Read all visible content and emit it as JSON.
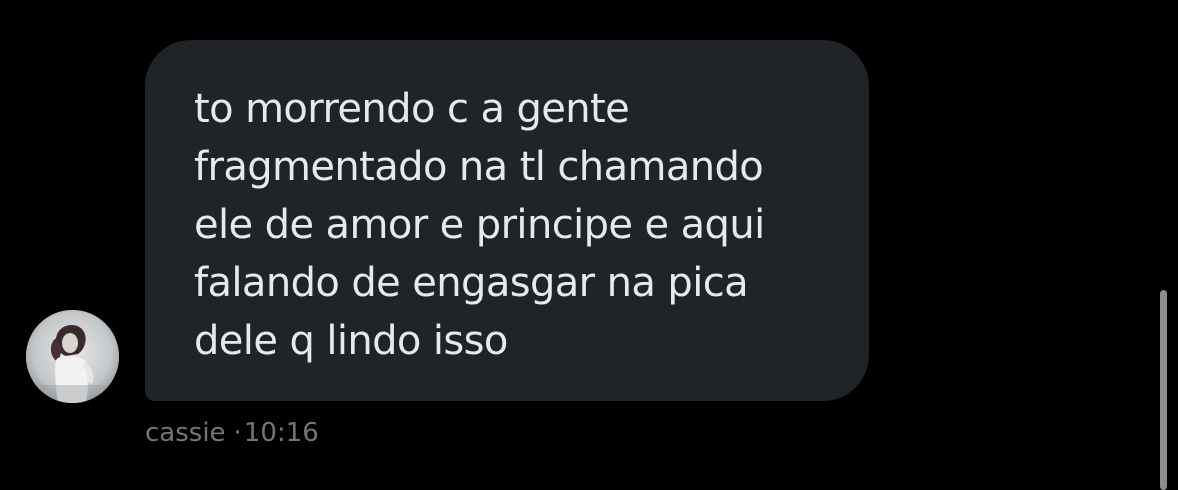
{
  "message": {
    "lines": [
      "to morrendo c a gente",
      "fragmentado na tl chamando",
      "ele de amor e principe e aqui",
      "falando de engasgar na pica",
      "dele q lindo isso"
    ]
  },
  "meta": {
    "sender": "cassie",
    "separator": "·",
    "time": "10:16"
  },
  "avatar": {
    "icon": "profile-photo"
  },
  "colors": {
    "background": "#000000",
    "bubble": "#202327",
    "text": "#e7e9ea",
    "meta_text": "#71767b",
    "scrollbar": "#8a8d90"
  }
}
